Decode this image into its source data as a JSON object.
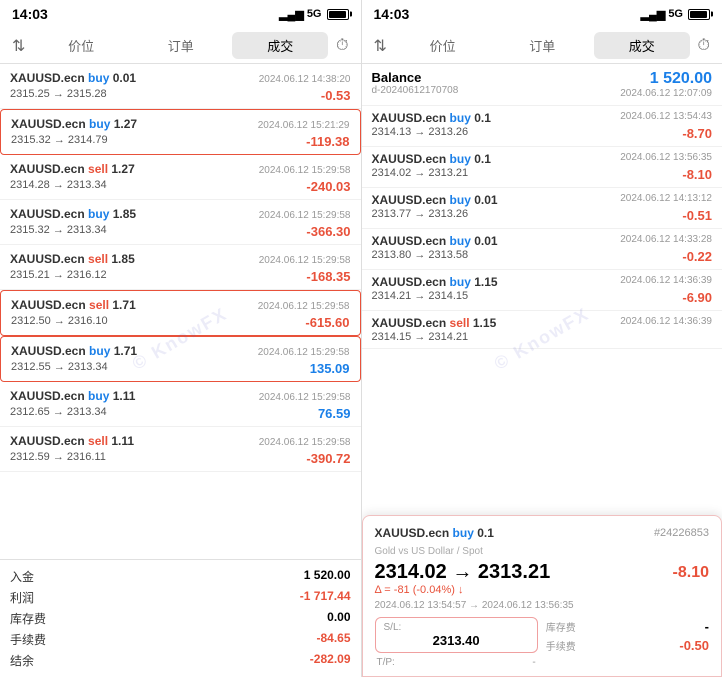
{
  "left_panel": {
    "status": {
      "time": "14:03",
      "signal": "5G",
      "battery": "85"
    },
    "tabs": {
      "sort_icon": "⇅",
      "items": [
        "价位",
        "订单",
        "成交"
      ],
      "active": 2,
      "clock": "🕐"
    },
    "trades": [
      {
        "symbol": "XAUUSD.ecn",
        "action": "buy",
        "size": "0.01",
        "price_from": "2315.25",
        "price_to": "2315.28",
        "date": "2024.06.12 14:38:20",
        "pnl": "-0.53",
        "pnl_type": "negative"
      },
      {
        "symbol": "XAUUSD.ecn",
        "action": "buy",
        "size": "1.27",
        "price_from": "2315.32",
        "price_to": "2314.79",
        "date": "2024.06.12 15:21:29",
        "pnl": "-119.38",
        "pnl_type": "negative",
        "highlight": true
      },
      {
        "symbol": "XAUUSD.ecn",
        "action": "sell",
        "size": "1.27",
        "price_from": "2314.28",
        "price_to": "2313.34",
        "date": "2024.06.12 15:29:58",
        "pnl": "-240.03",
        "pnl_type": "negative"
      },
      {
        "symbol": "XAUUSD.ecn",
        "action": "buy",
        "size": "1.85",
        "price_from": "2315.32",
        "price_to": "2313.34",
        "date": "2024.06.12 15:29:58",
        "pnl": "-366.30",
        "pnl_type": "negative"
      },
      {
        "symbol": "XAUUSD.ecn",
        "action": "sell",
        "size": "1.85",
        "price_from": "2315.21",
        "price_to": "2316.12",
        "date": "2024.06.12 15:29:58",
        "pnl": "-168.35",
        "pnl_type": "negative"
      },
      {
        "symbol": "XAUUSD.ecn",
        "action": "sell",
        "size": "1.71",
        "price_from": "2312.50",
        "price_to": "2316.10",
        "date": "2024.06.12 15:29:58",
        "pnl": "-615.60",
        "pnl_type": "negative",
        "highlight": true
      },
      {
        "symbol": "XAUUSD.ecn",
        "action": "buy",
        "size": "1.71",
        "price_from": "2312.55",
        "price_to": "2313.34",
        "date": "2024.06.12 15:29:58",
        "pnl": "135.09",
        "pnl_type": "positive",
        "highlight": true
      },
      {
        "symbol": "XAUUSD.ecn",
        "action": "buy",
        "size": "1.11",
        "price_from": "2312.65",
        "price_to": "2313.34",
        "date": "2024.06.12 15:29:58",
        "pnl": "76.59",
        "pnl_type": "positive"
      },
      {
        "symbol": "XAUUSD.ecn",
        "action": "sell",
        "size": "1.11",
        "price_from": "2312.59",
        "price_to": "2316.11",
        "date": "2024.06.12 15:29:58",
        "pnl": "-390.72",
        "pnl_type": "negative"
      }
    ],
    "footer": {
      "items": [
        {
          "label": "入金",
          "value": "1 520.00",
          "type": "normal"
        },
        {
          "label": "利润",
          "value": "-1 717.44",
          "type": "negative"
        },
        {
          "label": "库存费",
          "value": "0.00",
          "type": "normal"
        },
        {
          "label": "手续费",
          "value": "-84.65",
          "type": "negative"
        },
        {
          "label": "结余",
          "value": "-282.09",
          "type": "negative"
        }
      ]
    }
  },
  "right_panel": {
    "status": {
      "time": "14:03",
      "signal": "5G"
    },
    "tabs": {
      "sort_icon": "⇅",
      "items": [
        "价位",
        "订单",
        "成交"
      ],
      "active": 2,
      "clock": "🕐"
    },
    "balance": {
      "label": "Balance",
      "id": "d-20240612170708",
      "value": "1 520.00",
      "date": "2024.06.12 12:07:09"
    },
    "trades": [
      {
        "symbol": "XAUUSD.ecn",
        "action": "buy",
        "size": "0.1",
        "price_from": "2314.13",
        "price_to": "2313.26",
        "date": "2024.06.12 13:54:43",
        "pnl": "-8.70",
        "pnl_type": "negative"
      },
      {
        "symbol": "XAUUSD.ecn",
        "action": "buy",
        "size": "0.1",
        "price_from": "2314.02",
        "price_to": "2313.21",
        "date": "2024.06.12 13:56:35",
        "pnl": "-8.10",
        "pnl_type": "negative"
      },
      {
        "symbol": "XAUUSD.ecn",
        "action": "buy",
        "size": "0.01",
        "price_from": "2313.77",
        "price_to": "2313.26",
        "date": "2024.06.12 14:13:12",
        "pnl": "-0.51",
        "pnl_type": "negative"
      },
      {
        "symbol": "XAUUSD.ecn",
        "action": "buy",
        "size": "0.01",
        "price_from": "2313.80",
        "price_to": "2313.58",
        "date": "2024.06.12 14:33:28",
        "pnl": "-0.22",
        "pnl_type": "negative"
      },
      {
        "symbol": "XAUUSD.ecn",
        "action": "buy",
        "size": "1.15",
        "price_from": "2314.21",
        "price_to": "2314.15",
        "date": "2024.06.12 14:36:39",
        "pnl": "-6.90",
        "pnl_type": "negative"
      },
      {
        "symbol": "XAUUSD.ecn",
        "action": "sell",
        "size": "1.15",
        "price_from": "2314.15",
        "price_to": "2314.21",
        "date": "2024.06.12 14:36:39",
        "pnl": "",
        "pnl_type": "normal"
      }
    ],
    "popup": {
      "symbol": "XAUUSD.ecn buy 0.1",
      "id": "#24226853",
      "subtitle": "Gold vs US Dollar / Spot",
      "price_from": "2314.02",
      "price_to": "2313.21",
      "delta": "Δ = -81 (-0.04%)",
      "delta_arrow": "↓",
      "pnl": "-8.10",
      "time_from": "2024.06.12 13:54:57",
      "time_to": "2024.06.12 13:56:35",
      "sl_label": "S/L:",
      "sl_value": "2313.40",
      "tp_label": "T/P:",
      "tp_value": "-",
      "storage_label": "库存费",
      "storage_value": "-",
      "commission_label": "手续费",
      "commission_value": "-0.50"
    }
  },
  "watermark": "© KnowFX"
}
